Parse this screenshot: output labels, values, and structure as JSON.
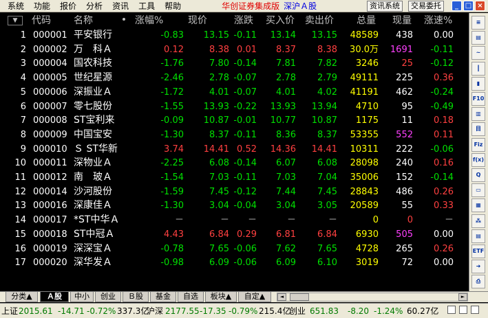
{
  "menu": [
    "系统",
    "功能",
    "报价",
    "分析",
    "资讯",
    "工具",
    "帮助"
  ],
  "app_title": "华创证券集成版",
  "market_title": "深沪Ａ股",
  "top_buttons": [
    "资讯系统",
    "交易委托"
  ],
  "window_buttons": [
    "_",
    "□",
    "×"
  ],
  "sort_indicator": "▼",
  "columns": [
    "代码",
    "名称",
    "涨幅%",
    "现价",
    "涨跌",
    "买入价",
    "卖出价",
    "总量",
    "现量",
    "涨速%"
  ],
  "rows": [
    {
      "idx": "1",
      "code": "000001",
      "name": "平安银行",
      "chg_pct": "-0.83",
      "price": "13.15",
      "chg": "-0.11",
      "bid": "13.14",
      "ask": "13.15",
      "vol": "48589",
      "cur_vol": "438",
      "speed": "0.00"
    },
    {
      "idx": "2",
      "code": "000002",
      "name": "万　科Ａ",
      "chg_pct": "0.12",
      "price": "8.38",
      "chg": "0.01",
      "bid": "8.37",
      "ask": "8.38",
      "vol": "30.0万",
      "cur_vol": "1691",
      "speed": "-0.11"
    },
    {
      "idx": "3",
      "code": "000004",
      "name": "国农科技",
      "chg_pct": "-1.76",
      "price": "7.80",
      "chg": "-0.14",
      "bid": "7.81",
      "ask": "7.82",
      "vol": "3246",
      "cur_vol": "25",
      "speed": "-0.12"
    },
    {
      "idx": "4",
      "code": "000005",
      "name": "世纪星源",
      "chg_pct": "-2.46",
      "price": "2.78",
      "chg": "-0.07",
      "bid": "2.78",
      "ask": "2.79",
      "vol": "49111",
      "cur_vol": "225",
      "speed": "0.36"
    },
    {
      "idx": "5",
      "code": "000006",
      "name": "深振业Ａ",
      "chg_pct": "-1.72",
      "price": "4.01",
      "chg": "-0.07",
      "bid": "4.01",
      "ask": "4.02",
      "vol": "41191",
      "cur_vol": "462",
      "speed": "-0.24"
    },
    {
      "idx": "6",
      "code": "000007",
      "name": "零七股份",
      "chg_pct": "-1.55",
      "price": "13.93",
      "chg": "-0.22",
      "bid": "13.93",
      "ask": "13.94",
      "vol": "4710",
      "cur_vol": "95",
      "speed": "-0.49"
    },
    {
      "idx": "7",
      "code": "000008",
      "name": "ST宝利来",
      "chg_pct": "-0.09",
      "price": "10.87",
      "chg": "-0.01",
      "bid": "10.77",
      "ask": "10.87",
      "vol": "1175",
      "cur_vol": "11",
      "speed": "0.18"
    },
    {
      "idx": "8",
      "code": "000009",
      "name": "中国宝安",
      "chg_pct": "-1.30",
      "price": "8.37",
      "chg": "-0.11",
      "bid": "8.36",
      "ask": "8.37",
      "vol": "53355",
      "cur_vol": "552",
      "speed": "0.11"
    },
    {
      "idx": "9",
      "code": "000010",
      "name": "Ｓ ST华新",
      "chg_pct": "3.74",
      "price": "14.41",
      "chg": "0.52",
      "bid": "14.36",
      "ask": "14.41",
      "vol": "10311",
      "cur_vol": "222",
      "speed": "-0.06"
    },
    {
      "idx": "10",
      "code": "000011",
      "name": "深物业Ａ",
      "chg_pct": "-2.25",
      "price": "6.08",
      "chg": "-0.14",
      "bid": "6.07",
      "ask": "6.08",
      "vol": "28098",
      "cur_vol": "240",
      "speed": "0.16"
    },
    {
      "idx": "11",
      "code": "000012",
      "name": "南　玻Ａ",
      "chg_pct": "-1.54",
      "price": "7.03",
      "chg": "-0.11",
      "bid": "7.03",
      "ask": "7.04",
      "vol": "35006",
      "cur_vol": "152",
      "speed": "-0.14"
    },
    {
      "idx": "12",
      "code": "000014",
      "name": "沙河股份",
      "chg_pct": "-1.59",
      "price": "7.45",
      "chg": "-0.12",
      "bid": "7.44",
      "ask": "7.45",
      "vol": "28843",
      "cur_vol": "486",
      "speed": "0.26"
    },
    {
      "idx": "13",
      "code": "000016",
      "name": "深康佳Ａ",
      "chg_pct": "-1.30",
      "price": "3.04",
      "chg": "-0.04",
      "bid": "3.04",
      "ask": "3.05",
      "vol": "20589",
      "cur_vol": "55",
      "speed": "0.33"
    },
    {
      "idx": "14",
      "code": "000017",
      "name": "*ST中华Ａ",
      "chg_pct": "－",
      "price": "－",
      "chg": "－",
      "bid": "－",
      "ask": "－",
      "vol": "0",
      "cur_vol": "0",
      "speed": "－"
    },
    {
      "idx": "15",
      "code": "000018",
      "name": "ST中冠Ａ",
      "chg_pct": "4.43",
      "price": "6.84",
      "chg": "0.29",
      "bid": "6.81",
      "ask": "6.84",
      "vol": "6930",
      "cur_vol": "505",
      "speed": "0.00"
    },
    {
      "idx": "16",
      "code": "000019",
      "name": "深深宝Ａ",
      "chg_pct": "-0.78",
      "price": "7.65",
      "chg": "-0.06",
      "bid": "7.62",
      "ask": "7.65",
      "vol": "4728",
      "cur_vol": "265",
      "speed": "0.26"
    },
    {
      "idx": "17",
      "code": "000020",
      "name": "深华发Ａ",
      "chg_pct": "-0.98",
      "price": "6.09",
      "chg": "-0.06",
      "bid": "6.09",
      "ask": "6.10",
      "vol": "3019",
      "cur_vol": "72",
      "speed": "0.00"
    }
  ],
  "tabs": [
    "分类▲",
    "Ａ股",
    "中小",
    "创业",
    "Ｂ股",
    "基金",
    "自选",
    "板块▲",
    "自定▲"
  ],
  "scroll_buttons": [
    "◄",
    "►"
  ],
  "status": {
    "sh_label": "上证",
    "sh_index": "2015.61",
    "sh_chg": "-14.71",
    "sh_pct": "-0.72%",
    "sh_amt": "337.3亿",
    "hs_label": "沪深",
    "hs_index": "2177.55",
    "hs_chg": "-17.35",
    "hs_pct": "-0.79%",
    "hs_amt": "215.4亿",
    "cy_label": "创业",
    "cy_index": "651.83",
    "cy_chg": "-8.20",
    "cy_pct": "-1.24%",
    "cy_amt": "60.27亿"
  },
  "toolbar_icons": [
    "doc-icon",
    "list-icon",
    "line-chart-icon",
    "kline-icon",
    "bar-chart-icon",
    "f10-icon",
    "book-icon",
    "report-icon",
    "fiz-icon",
    "fx-icon",
    "search-icon",
    "folder-icon",
    "news-icon",
    "dice-icon",
    "calc-icon",
    "etf-icon",
    "exit-icon",
    "print-icon"
  ],
  "toolbar_labels": [
    "≡",
    "▤",
    "~",
    "┃",
    "▮",
    "F10",
    "▥",
    "目",
    "Fiz",
    "f(x)",
    "Q",
    "▭",
    "▦",
    "⁂",
    "▤",
    "ETF",
    "➜",
    "⎙"
  ],
  "colors": {
    "up": "#ff4040",
    "down": "#00e000",
    "neutral": "#ffff00",
    "big_vol": "#ff40ff"
  }
}
